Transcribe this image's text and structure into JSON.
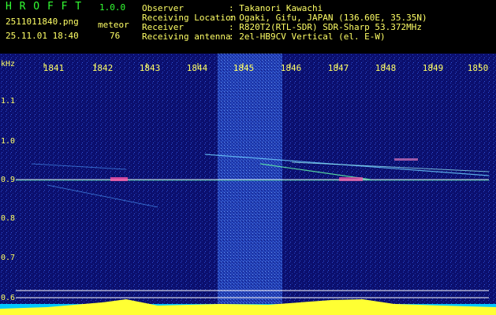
{
  "app": {
    "name": "H R O F F T",
    "version": "1.0.0",
    "file": "2511011840.png",
    "category": "meteor",
    "datetime": "25.11.01 18:40",
    "count": "76"
  },
  "info": {
    "observer_label": "Observer",
    "observer": ": Takanori Kawachi",
    "location_label": "Receiving Location",
    "location": ": Ogaki, Gifu, JAPAN (136.60E, 35.35N)",
    "receiver_label": "Receiver",
    "receiver": ": R820T2(RTL-SDR) SDR-Sharp 53.372MHz",
    "antenna_label": "Receiving antenna",
    "antenna": ": 2el-HB9CV Vertical (el. E-W)"
  },
  "axis": {
    "y_unit": "kHz",
    "x_ticks": [
      "1841",
      "1842",
      "1843",
      "1844",
      "1845",
      "1846",
      "1847",
      "1848",
      "1849",
      "1850"
    ],
    "y_ticks": [
      "1.1",
      "1.0",
      "0.9",
      "0.8",
      "0.7",
      "0.6"
    ]
  },
  "colors": {
    "bg": "#0b0f6e",
    "accent": "#33ff33",
    "label": "#ffff66"
  }
}
